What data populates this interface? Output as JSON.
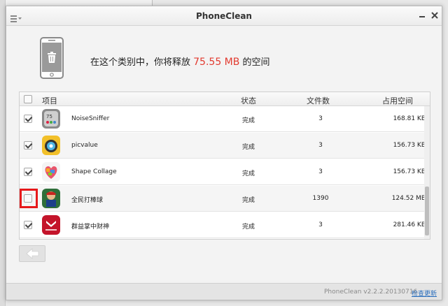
{
  "window": {
    "title": "PhoneClean"
  },
  "header": {
    "prefix": "在这个类别中，你将释放 ",
    "amount": "75.55 MB",
    "suffix": " 的空间"
  },
  "table": {
    "columns": {
      "item": "项目",
      "status": "状态",
      "files": "文件数",
      "size": "占用空间"
    },
    "rows": [
      {
        "name": "NoiseSniffer",
        "status": "完成",
        "files": "3",
        "size": "168.81 KB",
        "checked": true
      },
      {
        "name": "picvalue",
        "status": "完成",
        "files": "3",
        "size": "156.73 KB",
        "checked": true
      },
      {
        "name": "Shape Collage",
        "status": "完成",
        "files": "3",
        "size": "156.73 KB",
        "checked": true
      },
      {
        "name": "全民打棒球",
        "status": "完成",
        "files": "1390",
        "size": "124.52 MB",
        "checked": false
      },
      {
        "name": "群益掌中财神",
        "status": "完成",
        "files": "3",
        "size": "281.46 KB",
        "checked": true
      }
    ]
  },
  "footer": {
    "version": "PhoneClean v2.2.2.20130716",
    "update": "检查更新"
  },
  "colors": {
    "accent": "#e23a2f",
    "highlight": "#e6191b",
    "link": "#2a6ebd"
  },
  "icons": {
    "menu": "menu-icon",
    "phone": "phone-trash-icon",
    "back": "back-arrow-icon"
  }
}
